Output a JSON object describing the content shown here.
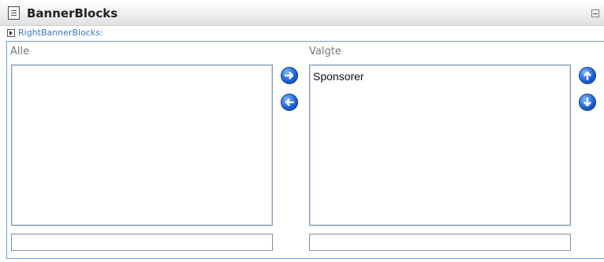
{
  "header": {
    "title": "BannerBlocks"
  },
  "sub": {
    "label": "RightBannerBlocks:"
  },
  "columns": {
    "all_label": "Alle",
    "selected_label": "Valgte"
  },
  "lists": {
    "all_items": [],
    "selected_items": [
      "Sponsorer"
    ]
  },
  "inputs": {
    "all_filter_value": "",
    "selected_filter_value": ""
  },
  "icons": {
    "header": "document-icon",
    "collapse": "minus-box-icon",
    "expand": "triangle-right-icon",
    "move_right": "arrow-right-icon",
    "move_left": "arrow-left-icon",
    "move_up": "arrow-up-icon",
    "move_down": "arrow-down-icon"
  },
  "colors": {
    "panel_border": "#6f9fd8",
    "link_blue": "#3a78c8",
    "button_blue": "#1e63d6"
  }
}
